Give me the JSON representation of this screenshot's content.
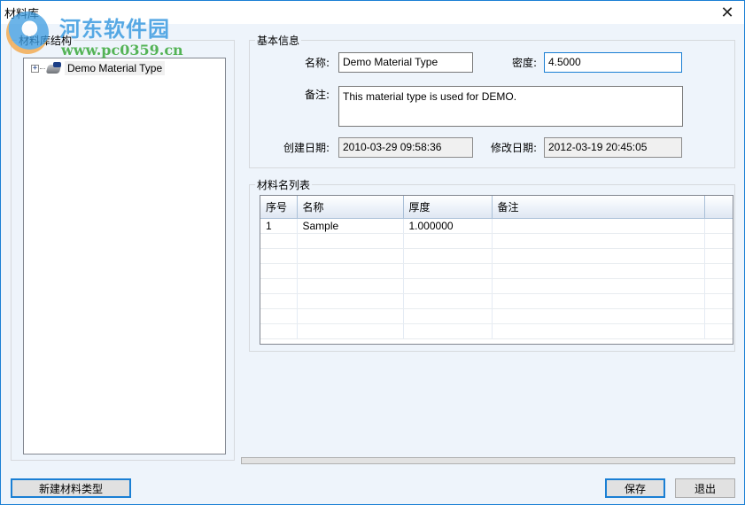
{
  "window": {
    "title": "材料库",
    "close_icon": "close-icon"
  },
  "watermark": {
    "brand_cn": "河东软件园",
    "url": "www.pc0359.cn"
  },
  "left_panel": {
    "legend": "材料库结构",
    "tree": [
      {
        "label": "Demo Material Type",
        "expanded": false,
        "icon": "material-type-icon"
      }
    ]
  },
  "basic_info": {
    "legend": "基本信息",
    "name_label": "名称:",
    "name_value": "Demo Material Type",
    "density_label": "密度:",
    "density_value": "4.5000",
    "remark_label": "备注:",
    "remark_value": "This material type is used for DEMO.",
    "created_label": "创建日期:",
    "created_value": "2010-03-29 09:58:36",
    "modified_label": "修改日期:",
    "modified_value": "2012-03-19 20:45:05"
  },
  "material_list": {
    "legend": "材料名列表",
    "columns": [
      "序号",
      "名称",
      "厚度",
      "备注",
      ""
    ],
    "rows": [
      [
        "1",
        "Sample",
        "1.000000",
        "",
        ""
      ]
    ],
    "empty_rows": 7
  },
  "progress": {
    "value_percent": 0
  },
  "buttons": {
    "new_type": "新建材料类型",
    "save": "保存",
    "exit": "退出"
  }
}
